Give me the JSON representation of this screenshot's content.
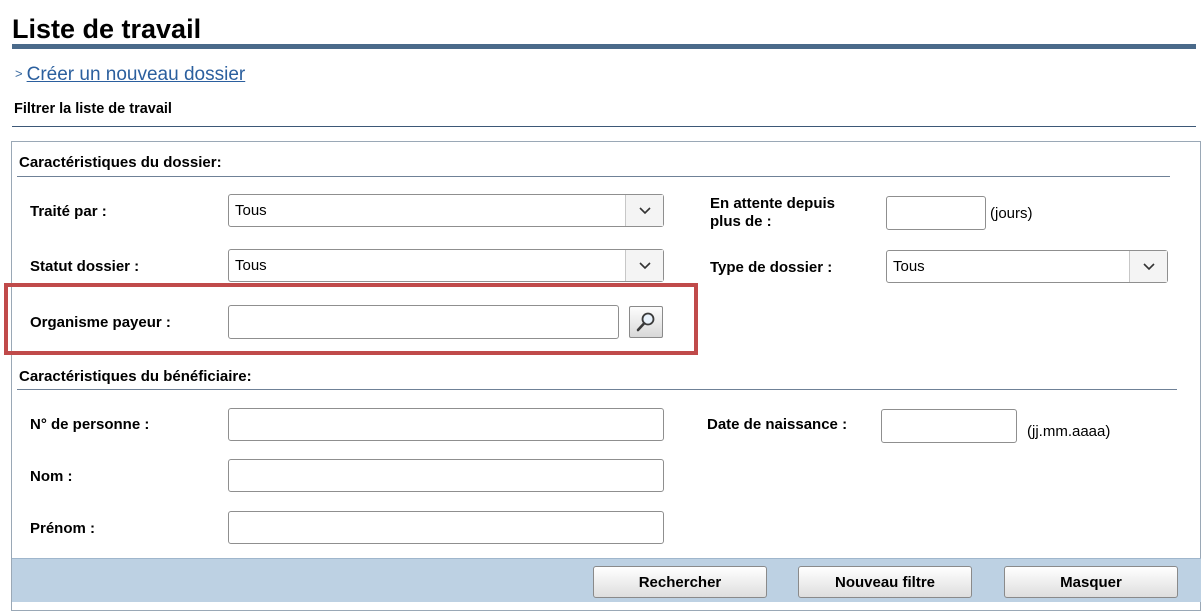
{
  "header": {
    "title": "Liste de travail",
    "create_link": "Créer un nouveau dossier",
    "filter_title": "Filtrer la liste de travail"
  },
  "dossier_section": {
    "title": "Caractéristiques du dossier:",
    "traite_par": {
      "label": "Traité par :",
      "value": "Tous"
    },
    "en_attente": {
      "label_line1": "En attente depuis",
      "label_line2": "plus de :",
      "value": "",
      "unit": "(jours)"
    },
    "statut": {
      "label": "Statut dossier :",
      "value": "Tous"
    },
    "type": {
      "label": "Type de dossier :",
      "value": "Tous"
    },
    "organisme": {
      "label": "Organisme payeur :",
      "value": ""
    }
  },
  "beneficiaire_section": {
    "title": "Caractéristiques du bénéficiaire:",
    "personne": {
      "label": "N° de personne :",
      "value": ""
    },
    "naissance": {
      "label": "Date de naissance :",
      "value": "",
      "format": "(jj.mm.aaaa)"
    },
    "nom": {
      "label": "Nom :",
      "value": ""
    },
    "prenom": {
      "label": "Prénom :",
      "value": ""
    }
  },
  "buttons": {
    "rechercher": "Rechercher",
    "nouveau_filtre": "Nouveau filtre",
    "masquer": "Masquer"
  },
  "icons": {
    "dropdown": "chevron-down-icon",
    "lookup": "magnifier-icon"
  },
  "colors": {
    "highlight": "#c04a4a",
    "footer": "#bdd1e3",
    "link": "#2b5f9e",
    "rule": "#4a6a8a"
  }
}
